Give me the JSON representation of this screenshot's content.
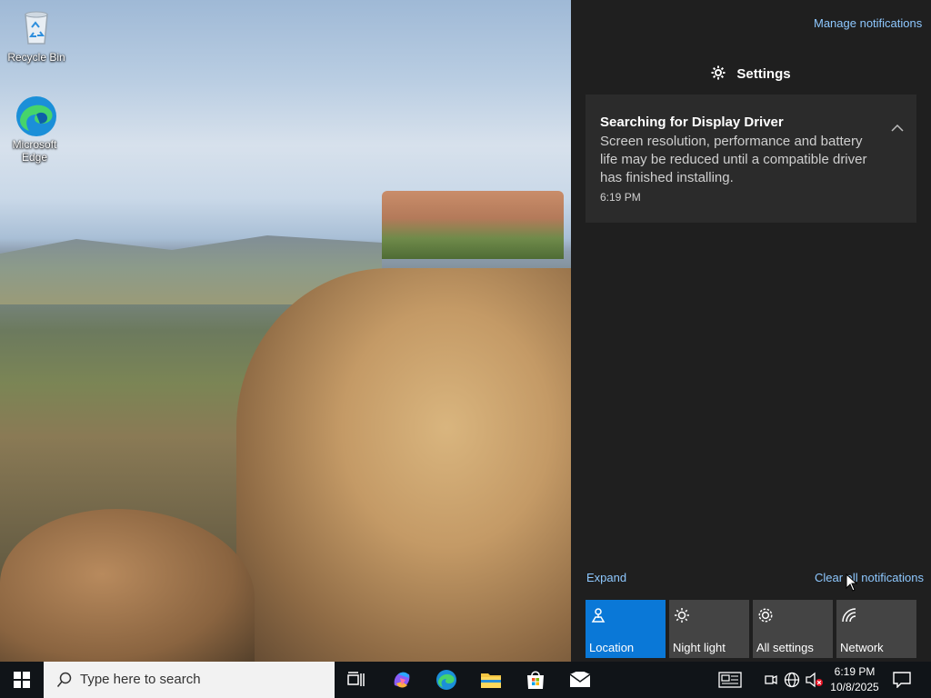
{
  "desktop": {
    "icons": [
      {
        "label": "Recycle Bin",
        "icon": "recycle-bin-icon"
      },
      {
        "label": "Microsoft Edge",
        "icon": "edge-icon"
      }
    ]
  },
  "action_center": {
    "manage_notifications": "Manage notifications",
    "group_header": "Settings",
    "notification": {
      "title": "Searching for Display Driver",
      "body": "Screen resolution, performance and battery life may be reduced until a compatible driver has finished installing.",
      "time": "6:19 PM"
    },
    "expand": "Expand",
    "clear_all": "Clear all notifications",
    "quick_actions": [
      {
        "label": "Location",
        "icon": "location-icon",
        "active": true
      },
      {
        "label": "Night light",
        "icon": "night-light-icon",
        "active": false
      },
      {
        "label": "All settings",
        "icon": "gear-icon",
        "active": false
      },
      {
        "label": "Network",
        "icon": "network-icon",
        "active": false
      }
    ]
  },
  "taskbar": {
    "search_placeholder": "Type here to search",
    "pinned": [
      "task-view-icon",
      "copilot-icon",
      "edge-icon",
      "file-explorer-icon",
      "microsoft-store-icon",
      "mail-icon"
    ],
    "tray": [
      "news-icon",
      "meet-now-icon",
      "language-icon",
      "volume-muted-icon"
    ],
    "time": "6:19 PM",
    "date": "10/8/2025"
  },
  "colors": {
    "accent": "#0a78d7",
    "link": "#8ec8ff",
    "panel_bg": "#1f1f1f",
    "card_bg": "#2b2b2b",
    "tile_bg": "#444444"
  }
}
